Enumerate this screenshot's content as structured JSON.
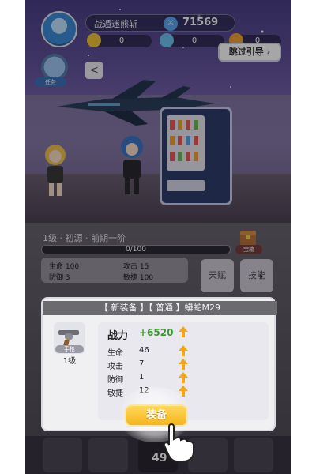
{
  "header": {
    "player_name": "战遁迷熊斩",
    "power": "71569",
    "resources": [
      "0",
      "0",
      "0"
    ],
    "skip_label": "跳过引导",
    "back_label": "<",
    "side_badge_label": "任务"
  },
  "progress": {
    "level_label": "1级 · 初源 · 前期一阶",
    "xp_text": "0/100",
    "xp_fraction": 0.0
  },
  "base_stats": [
    {
      "label": "生命",
      "value": "100"
    },
    {
      "label": "攻击",
      "value": "15"
    },
    {
      "label": "防御",
      "value": "3"
    },
    {
      "label": "敏捷",
      "value": "100"
    }
  ],
  "side_buttons": [
    "天赋",
    "技能"
  ],
  "chest_label": "宝箱",
  "modal": {
    "title": "【 新装备 】【 普通 】蟒蛇M29",
    "item_tag": "手枪",
    "item_level": "1级",
    "stats": [
      {
        "label": "战力",
        "value": "+6520"
      },
      {
        "label": "生命",
        "value": "46"
      },
      {
        "label": "攻击",
        "value": "7"
      },
      {
        "label": "防御",
        "value": "1"
      },
      {
        "label": "敏捷",
        "value": "12"
      }
    ],
    "equip_label": "装备"
  },
  "bottom_nav": {
    "center_number": "49"
  },
  "colors": {
    "accent_gold": "#f6b51c",
    "power_green": "#3a9a2a",
    "arrow_orange": "#f2a61a"
  }
}
